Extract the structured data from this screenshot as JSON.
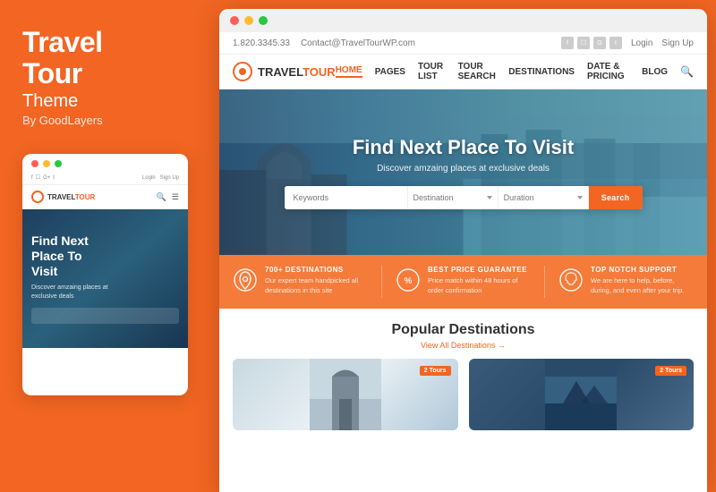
{
  "left": {
    "title": "Travel\nTour",
    "subtitle": "Theme",
    "byline": "By GoodLayers"
  },
  "mobile": {
    "hero_title": "Find Next\nPlace To\nVisit",
    "hero_sub": "Discover amzaing places at\nexclusive deals"
  },
  "topbar": {
    "phone": "1.820.3345.33",
    "email": "Contact@TravelTourWP.com",
    "login": "Login",
    "signup": "Sign Up"
  },
  "nav": {
    "logo_travel": "TRAVEL",
    "logo_tour": "TOUR",
    "links": [
      "HOME",
      "PAGES",
      "TOUR LIST",
      "TOUR SEARCH",
      "DESTINATIONS",
      "DATE & PRICING",
      "BLOG"
    ]
  },
  "hero": {
    "title": "Find Next Place To Visit",
    "subtitle": "Discover amzaing places at exclusive deals",
    "search_keyword_placeholder": "Keywords",
    "search_destination_placeholder": "Destination",
    "search_duration_placeholder": "Duration",
    "search_btn": "Search"
  },
  "features": [
    {
      "icon": "⊕",
      "title": "700+ DESTINATIONS",
      "desc": "Our expert team handpicked all destinations in this site"
    },
    {
      "icon": "%",
      "title": "BEST PRICE GUARANTEE",
      "desc": "Price match within 48 hours of order confirmation"
    },
    {
      "icon": "☎",
      "title": "TOP NOTCH SUPPORT",
      "desc": "We are here to help, before, during, and even after your trip."
    }
  ],
  "popular": {
    "title": "Popular Destinations",
    "view_all": "View All Destinations →",
    "cards": [
      {
        "badge": "2 Tours"
      },
      {
        "badge": "2 Tours"
      }
    ]
  }
}
